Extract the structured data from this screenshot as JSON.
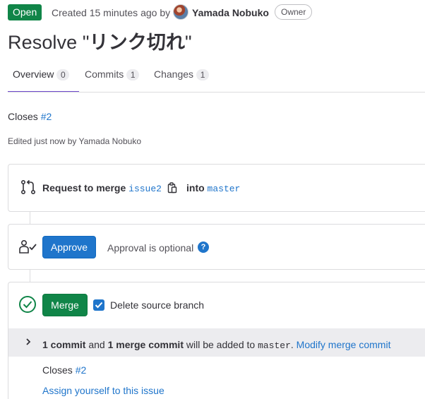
{
  "header": {
    "status": "Open",
    "created": "Created 15 minutes ago by",
    "author": "Yamada Nobuko",
    "role": "Owner"
  },
  "title": {
    "prefix": "Resolve \"",
    "name": "リンク切れ",
    "suffix": "\""
  },
  "tabs": [
    {
      "label": "Overview",
      "count": "0"
    },
    {
      "label": "Commits",
      "count": "1"
    },
    {
      "label": "Changes",
      "count": "1"
    }
  ],
  "description": {
    "closes_label": "Closes",
    "closes_issue": "#2",
    "edited": "Edited just now by Yamada Nobuko"
  },
  "merge_request": {
    "label": "Request to merge",
    "source_branch": "issue2",
    "into_label": "into",
    "target_branch": "master"
  },
  "approval": {
    "button": "Approve",
    "text": "Approval is optional",
    "help": "?"
  },
  "merge": {
    "button": "Merge",
    "delete_source_label": "Delete source branch",
    "delete_source_checked": true
  },
  "commit_info": {
    "count_1": "1 commit",
    "and": "and",
    "count_2": "1 merge commit",
    "added": "will be added to",
    "branch": "master",
    "period": ".",
    "modify_link": "Modify merge commit"
  },
  "footer": {
    "closes_label": "Closes",
    "closes_issue": "#2",
    "assign_link": "Assign yourself to this issue"
  },
  "colors": {
    "open_badge": "#108548",
    "primary": "#1f75cb",
    "tab_indicator": "#6e49cb",
    "commit_bar": "#ececef"
  }
}
